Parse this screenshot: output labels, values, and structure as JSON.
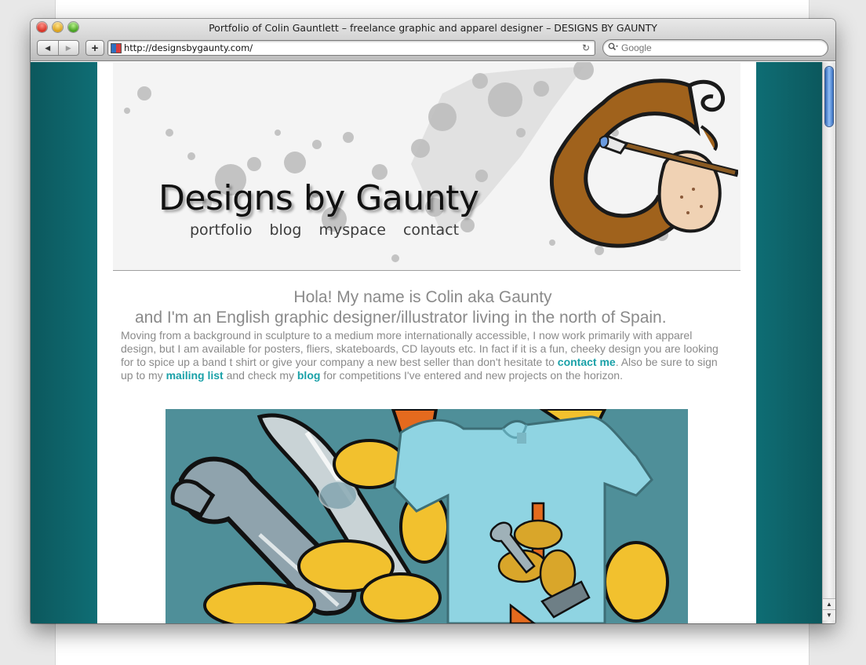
{
  "window": {
    "title": "Portfolio of Colin Gauntlett – freelance graphic and apparel designer – DESIGNS BY GAUNTY",
    "url": "http://designsbygaunty.com/",
    "search_placeholder": "Google",
    "back_glyph": "◀",
    "forward_glyph": "▶",
    "add_glyph": "+",
    "reload_glyph": "↻"
  },
  "header": {
    "title": "Designs by Gaunty",
    "nav": [
      "portfolio",
      "blog",
      "myspace",
      "contact"
    ],
    "logo_icon": "paintbrush-hand-G-logo"
  },
  "intro": {
    "heading_line1": "Hola! My name is Colin aka Gaunty",
    "heading_line2": "and I'm an English graphic designer/illustrator living in the north of Spain.",
    "body_part1": "Moving from a background in sculpture to a medium more internationally accessible, I now work primarily with apparel design, but I am available for posters, fliers, skateboards, CD layouts etc. In fact if it is a fun, cheeky design you are looking for to spice up a band t shirt or give your company a new best seller than don't hesitate to ",
    "link_contact": "contact me",
    "body_part2": ". Also be sure to sign up to my ",
    "link_mailing": "mailing list",
    "body_part3": " and check my ",
    "link_blog": "blog",
    "body_part4": " for competitions I've entered and new projects on the horizon."
  },
  "featured_art_icon": "wrench-rope-tshirt-illustration",
  "colors": {
    "background_teal": "#0f6f76",
    "link": "#1aa1a8",
    "text_gray": "#8a8a8a",
    "logo_brown": "#a0621c"
  }
}
